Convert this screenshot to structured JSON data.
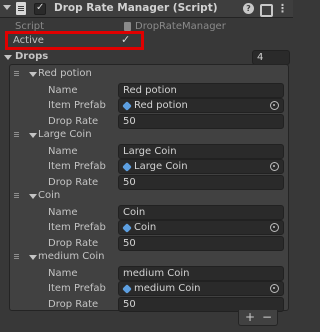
{
  "header": {
    "title": "Drop Rate Manager (Script)",
    "help_glyph": "?",
    "more_glyph": "⋮"
  },
  "script": {
    "label": "Script",
    "value": "DropRateManager"
  },
  "active": {
    "label": "Active",
    "checked": true
  },
  "drops": {
    "label": "Drops",
    "size": "4",
    "items": [
      {
        "name_heading": "Red potion",
        "name_label": "Name",
        "name_value": "Red potion",
        "prefab_label": "Item Prefab",
        "prefab_value": "Red potion",
        "rate_label": "Drop Rate",
        "rate_value": "50"
      },
      {
        "name_heading": "Large Coin",
        "name_label": "Name",
        "name_value": "Large Coin",
        "prefab_label": "Item Prefab",
        "prefab_value": "Large Coin",
        "rate_label": "Drop Rate",
        "rate_value": "50"
      },
      {
        "name_heading": "Coin",
        "name_label": "Name",
        "name_value": "Coin",
        "prefab_label": "Item Prefab",
        "prefab_value": "Coin",
        "rate_label": "Drop Rate",
        "rate_value": "50"
      },
      {
        "name_heading": "medium Coin",
        "name_label": "Name",
        "name_value": "medium Coin",
        "prefab_label": "Item Prefab",
        "prefab_value": "medium Coin",
        "rate_label": "Drop Rate",
        "rate_value": "50"
      }
    ],
    "add_label": "+",
    "remove_label": "−"
  },
  "colors": {
    "highlight": "#e00000",
    "prefab_icon": "#5d9fe0"
  }
}
